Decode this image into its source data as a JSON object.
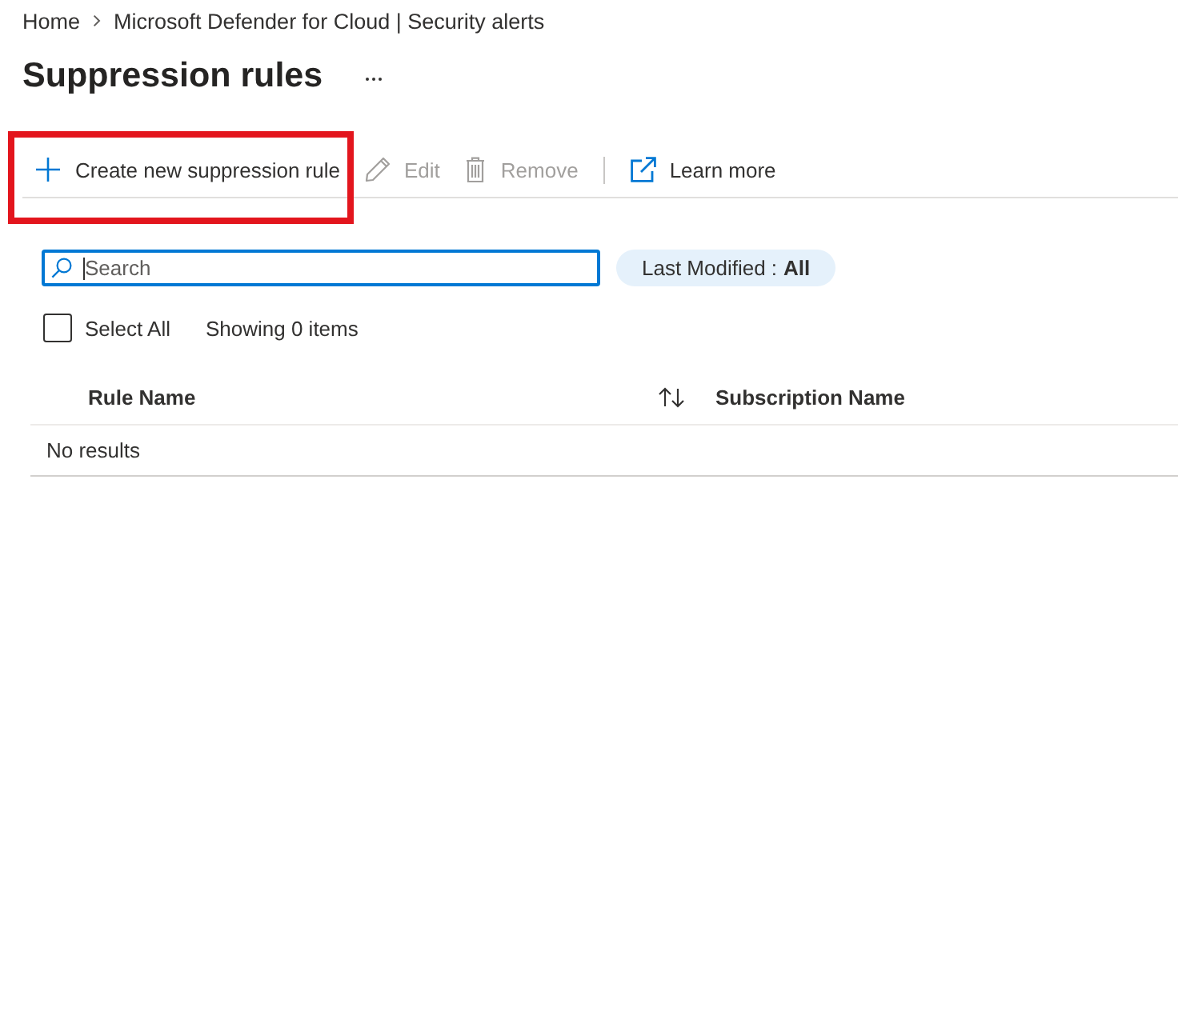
{
  "breadcrumb": [
    {
      "label": "Home"
    },
    {
      "label": "Microsoft Defender for Cloud | Security alerts"
    }
  ],
  "title": "Suppression rules",
  "toolbar": [
    {
      "kind": "add",
      "label": "Create new suppression rule",
      "disabled": false,
      "highlighted": true
    },
    {
      "kind": "edit",
      "label": "Edit",
      "disabled": true,
      "highlighted": false
    },
    {
      "kind": "delete",
      "label": "Remove",
      "disabled": true,
      "highlighted": false
    },
    {
      "kind": "separator"
    },
    {
      "kind": "link",
      "label": "Learn more",
      "disabled": false,
      "highlighted": false
    }
  ],
  "search": {
    "placeholder": "Search",
    "focused": true
  },
  "filter": {
    "label": "Last Modified :",
    "value": "All"
  },
  "select_all": {
    "label": "Select All",
    "checked": false
  },
  "count": "Showing 0 items",
  "table": {
    "columns": [
      {
        "label": "Rule Name",
        "sortable": true
      },
      {
        "label": "Subscription Name",
        "sortable": false
      }
    ],
    "empty_message": "No results"
  }
}
